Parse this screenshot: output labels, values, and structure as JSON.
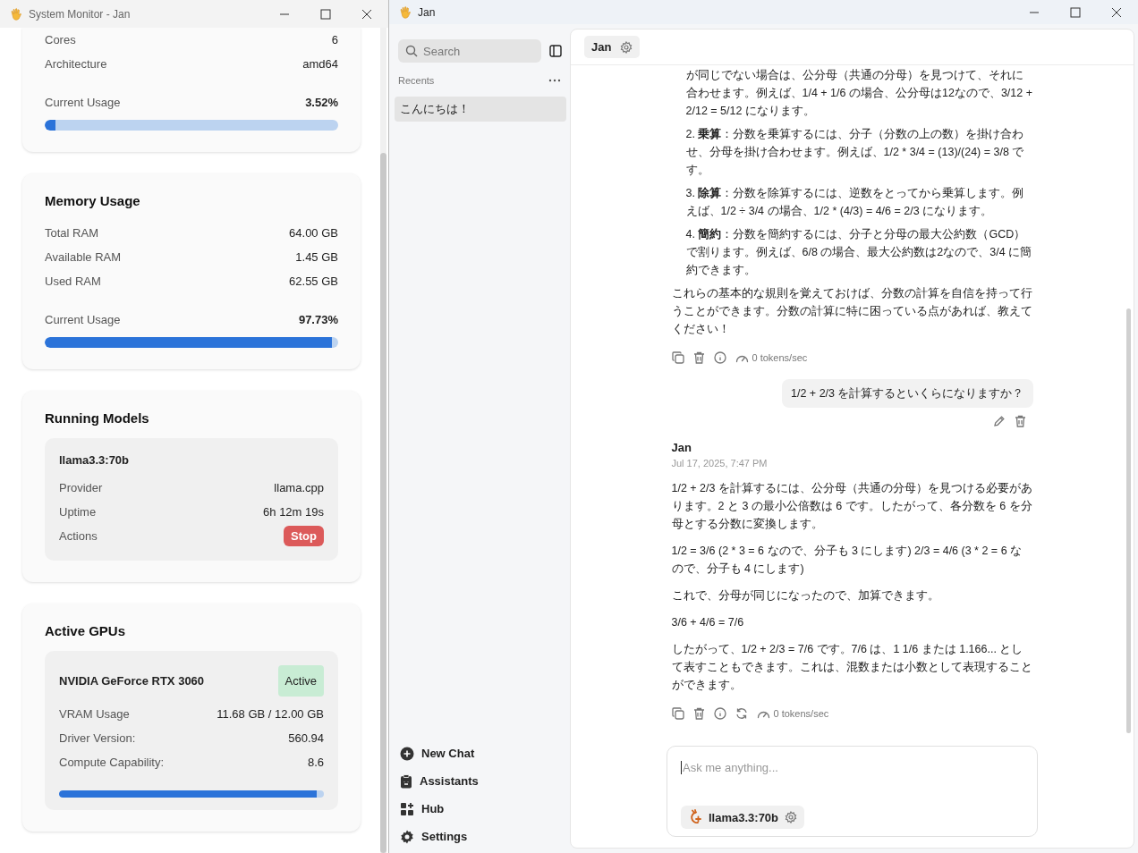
{
  "system_monitor": {
    "title": "System Monitor - Jan",
    "cpu": {
      "rows": [
        {
          "label": "Cores",
          "value": "6"
        },
        {
          "label": "Architecture",
          "value": "amd64"
        }
      ],
      "usage_label": "Current Usage",
      "usage_value": "3.52%",
      "level": 0.0352
    },
    "memory": {
      "title": "Memory Usage",
      "rows": [
        {
          "label": "Total RAM",
          "value": "64.00 GB"
        },
        {
          "label": "Available RAM",
          "value": "1.45 GB"
        },
        {
          "label": "Used RAM",
          "value": "62.55 GB"
        }
      ],
      "usage_label": "Current Usage",
      "usage_value": "97.73%",
      "level": 0.9773
    },
    "running_models": {
      "title": "Running Models",
      "models": [
        {
          "name": "llama3.3:70b",
          "rows": [
            {
              "label": "Provider",
              "value": "llama.cpp"
            },
            {
              "label": "Uptime",
              "value": "6h 12m 19s"
            }
          ],
          "actions_label": "Actions",
          "action_button": "Stop"
        }
      ]
    },
    "gpus": {
      "title": "Active GPUs",
      "items": [
        {
          "name": "NVIDIA GeForce RTX 3060",
          "status": "Active",
          "rows": [
            {
              "label": "VRAM Usage",
              "value": "11.68 GB / 12.00 GB"
            },
            {
              "label": "Driver Version:",
              "value": "560.94"
            },
            {
              "label": "Compute Capability:",
              "value": "8.6"
            }
          ],
          "level": 0.973
        }
      ]
    }
  },
  "jan": {
    "title": "Jan",
    "search": {
      "placeholder": "Search"
    },
    "recents_label": "Recents",
    "threads": [
      {
        "title": "こんにちは！",
        "selected": true
      }
    ],
    "nav": [
      {
        "label": "New Chat",
        "kind": "new"
      },
      {
        "label": "Assistants",
        "kind": "assistants"
      },
      {
        "label": "Hub",
        "kind": "hub"
      },
      {
        "label": "Settings",
        "kind": "settings"
      }
    ],
    "header": {
      "assistant": "Jan"
    },
    "messages": [
      {
        "kind": "assistant",
        "blocks": [
          {
            "kind": "list-item",
            "text": "が同じでない場合は、公分母（共通の分母）を見つけて、それに合わせます。例えば、1/4 + 1/6 の場合、公分母は12なので、3/12 + 2/12 = 5/12 になります。"
          },
          {
            "kind": "list-item",
            "text": "2. **乗算**：分数を乗算するには、分子（分数の上の数）を掛け合わせ、分母を掛け合わせます。例えば、1/2 * 3/4 = (13)/(24) = 3/8 です。"
          },
          {
            "kind": "list-item",
            "text": "3. **除算**：分数を除算するには、逆数をとってから乗算します。例えば、1/2 ÷ 3/4 の場合、1/2 * (4/3) = 4/6 = 2/3 になります。"
          },
          {
            "kind": "list-item",
            "text": "4. **簡約**：分数を簡約するには、分子と分母の最大公約数（GCD）で割ります。例えば、6/8 の場合、最大公約数は2なので、3/4 に簡約できます。"
          },
          {
            "kind": "paragraph",
            "text": "これらの基本的な規則を覚えておけば、分数の計算を自信を持って行うことができます。分数の計算に特に困っている点があれば、教えてください！"
          }
        ],
        "can_regenerate": false,
        "speed": "0 tokens/sec"
      },
      {
        "kind": "user",
        "text": "1/2 + 2/3 を計算するといくらになりますか？"
      },
      {
        "kind": "assistant",
        "author": "Jan",
        "time": "Jul 17, 2025, 7:47 PM",
        "blocks": [
          {
            "kind": "paragraph",
            "text": "1/2 + 2/3 を計算するには、公分母（共通の分母）を見つける必要があります。2 と 3 の最小公倍数は 6 です。したがって、各分数を 6 を分母とする分数に変換します。"
          },
          {
            "kind": "paragraph",
            "text": "1/2 = 3/6 (2 * 3 = 6 なので、分子も 3 にします) 2/3 = 4/6 (3 * 2 = 6 なので、分子も 4 にします)"
          },
          {
            "kind": "paragraph",
            "text": "これで、分母が同じになったので、加算できます。"
          },
          {
            "kind": "paragraph",
            "text": "3/6 + 4/6 = 7/6"
          },
          {
            "kind": "paragraph",
            "text": "したがって、1/2 + 2/3 = 7/6 です。7/6 は、1 1/6 または 1.166... として表すこともできます。これは、混数または小数として表現することができます。"
          }
        ],
        "can_regenerate": true,
        "speed": "0 tokens/sec"
      }
    ],
    "composer": {
      "placeholder": "Ask me anything...",
      "model": "llama3.3:70b"
    }
  }
}
